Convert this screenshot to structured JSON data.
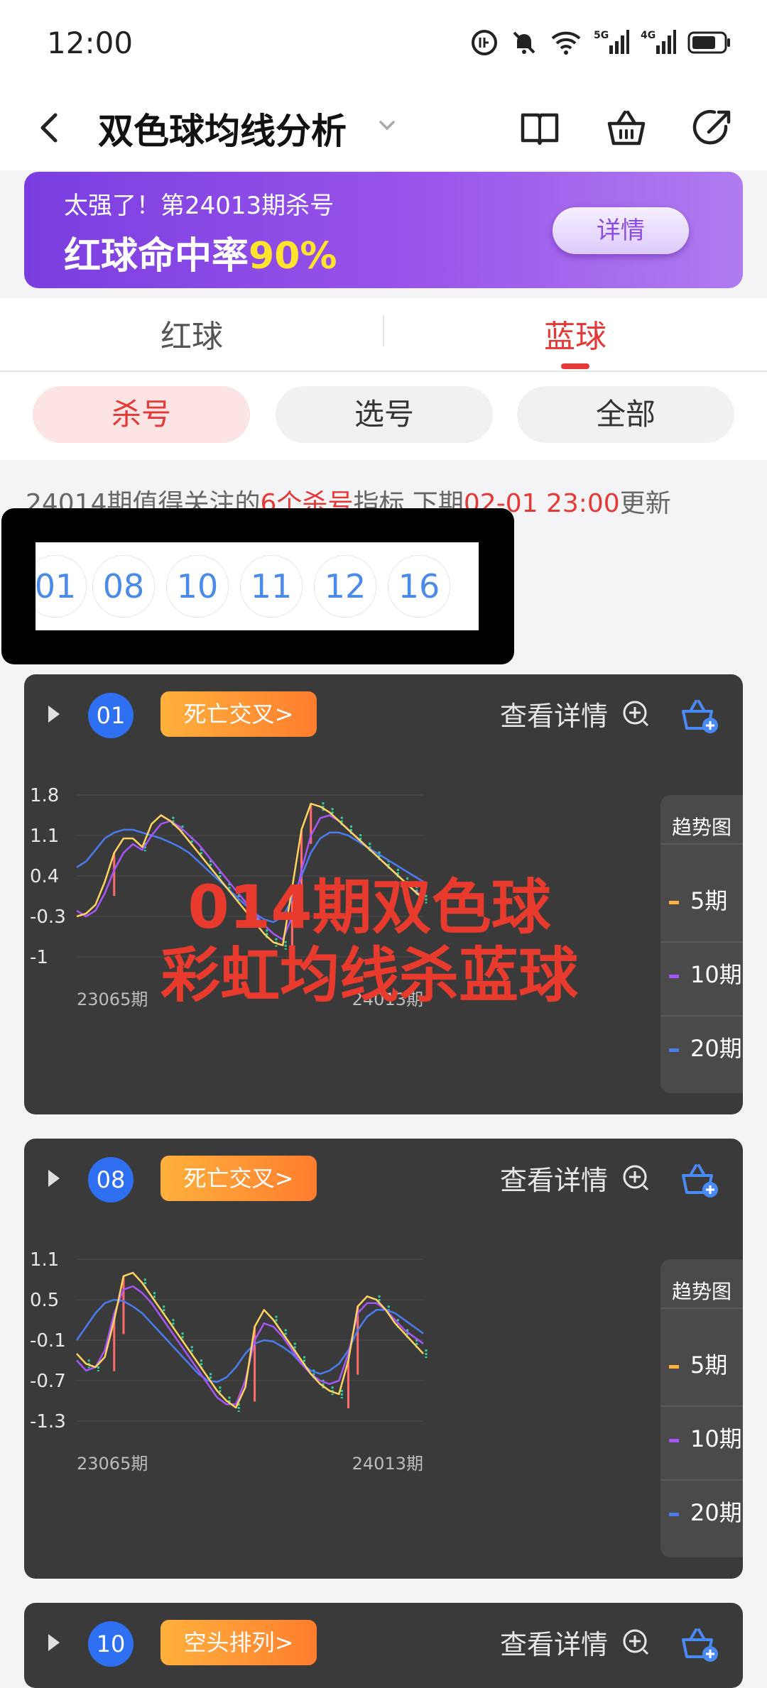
{
  "status": {
    "time": "12:00"
  },
  "header": {
    "title": "双色球均线分析"
  },
  "banner": {
    "line1": "太强了！第24013期杀号",
    "line2_prefix": "红球命中率",
    "line2_rate": "90%",
    "button": "详情"
  },
  "tabs": [
    {
      "label": "红球"
    },
    {
      "label": "蓝球"
    }
  ],
  "filters": [
    {
      "label": "杀号"
    },
    {
      "label": "选号"
    },
    {
      "label": "全部"
    }
  ],
  "notice": {
    "prefix": "24014期值得关注的",
    "count": "6个杀号",
    "mid": "指标 下期",
    "time": "02-01 23:00",
    "suffix": "更新"
  },
  "kill_numbers": [
    "01",
    "08",
    "10",
    "11",
    "12",
    "16"
  ],
  "colors": {
    "ma5": "#ffd460",
    "ma10": "#a855f7",
    "ma20": "#4a7cf0",
    "bull": "#2ed39a",
    "bear": "#ff6b6b"
  },
  "watermark": {
    "line1": "014期双色球",
    "line2": "彩虹均线杀蓝球"
  },
  "cards": [
    {
      "number": "01",
      "tag": "死亡交叉>",
      "detail": "查看详情",
      "legend_title": "趋势图",
      "legend": [
        "5期",
        "10期",
        "20期"
      ],
      "chart_data": {
        "type": "line",
        "yticks": [
          "1.8",
          "1.1",
          "0.4",
          "-0.3",
          "-1"
        ],
        "ylim": [
          -1,
          1.8
        ],
        "x_start": "23065期",
        "x_end": "24013期",
        "series": [
          {
            "name": "5期",
            "values": [
              -0.3,
              -0.25,
              -0.1,
              0.3,
              0.8,
              1.05,
              1.05,
              0.9,
              1.3,
              1.45,
              1.35,
              1.2,
              1.0,
              0.8,
              0.6,
              0.4,
              0.2,
              0.0,
              -0.2,
              -0.4,
              -0.6,
              -0.75,
              -0.8,
              0.2,
              1.2,
              1.65,
              1.6,
              1.5,
              1.35,
              1.2,
              1.05,
              0.9,
              0.75,
              0.6,
              0.45,
              0.3,
              0.15,
              0.0
            ]
          },
          {
            "name": "10期",
            "values": [
              -0.2,
              -0.3,
              -0.2,
              0.1,
              0.5,
              0.8,
              0.95,
              0.85,
              1.1,
              1.3,
              1.35,
              1.25,
              1.1,
              0.95,
              0.75,
              0.55,
              0.35,
              0.15,
              -0.05,
              -0.25,
              -0.45,
              -0.6,
              -0.7,
              -0.3,
              0.5,
              1.1,
              1.4,
              1.45,
              1.35,
              1.2,
              1.05,
              0.9,
              0.75,
              0.6,
              0.45,
              0.3,
              0.15,
              0.05
            ]
          },
          {
            "name": "20期",
            "values": [
              0.55,
              0.65,
              0.85,
              1.05,
              1.15,
              1.2,
              1.2,
              1.15,
              1.1,
              1.05,
              0.98,
              0.9,
              0.8,
              0.65,
              0.5,
              0.35,
              0.2,
              0.05,
              -0.1,
              -0.25,
              -0.35,
              -0.4,
              -0.3,
              0.0,
              0.4,
              0.8,
              1.05,
              1.15,
              1.15,
              1.1,
              1.0,
              0.9,
              0.8,
              0.7,
              0.6,
              0.5,
              0.4,
              0.3
            ]
          }
        ]
      }
    },
    {
      "number": "08",
      "tag": "死亡交叉>",
      "detail": "查看详情",
      "legend_title": "趋势图",
      "legend": [
        "5期",
        "10期",
        "20期"
      ],
      "chart_data": {
        "type": "line",
        "yticks": [
          "1.1",
          "0.5",
          "-0.1",
          "-0.7",
          "-1.3"
        ],
        "ylim": [
          -1.3,
          1.1
        ],
        "x_start": "23065期",
        "x_end": "24013期",
        "series": [
          {
            "name": "5期",
            "values": [
              -0.3,
              -0.45,
              -0.5,
              -0.35,
              0.2,
              0.85,
              0.9,
              0.75,
              0.55,
              0.35,
              0.15,
              -0.05,
              -0.25,
              -0.45,
              -0.65,
              -0.85,
              -1.0,
              -1.1,
              -0.8,
              0.1,
              0.35,
              0.2,
              0.0,
              -0.2,
              -0.4,
              -0.6,
              -0.75,
              -0.85,
              -0.9,
              -0.4,
              0.4,
              0.55,
              0.5,
              0.35,
              0.15,
              0.0,
              -0.15,
              -0.3
            ]
          },
          {
            "name": "10期",
            "values": [
              -0.4,
              -0.55,
              -0.5,
              -0.25,
              0.3,
              0.65,
              0.7,
              0.6,
              0.45,
              0.25,
              0.05,
              -0.15,
              -0.35,
              -0.55,
              -0.75,
              -0.95,
              -1.05,
              -1.05,
              -0.7,
              -0.1,
              0.15,
              0.1,
              -0.05,
              -0.25,
              -0.45,
              -0.6,
              -0.7,
              -0.75,
              -0.7,
              -0.3,
              0.3,
              0.45,
              0.45,
              0.35,
              0.2,
              0.05,
              -0.05,
              -0.15
            ]
          },
          {
            "name": "20期",
            "values": [
              -0.1,
              0.1,
              0.3,
              0.45,
              0.5,
              0.48,
              0.4,
              0.3,
              0.15,
              0.0,
              -0.15,
              -0.3,
              -0.45,
              -0.6,
              -0.7,
              -0.72,
              -0.65,
              -0.5,
              -0.3,
              -0.15,
              -0.1,
              -0.12,
              -0.2,
              -0.3,
              -0.45,
              -0.55,
              -0.6,
              -0.55,
              -0.45,
              -0.25,
              0.05,
              0.25,
              0.35,
              0.35,
              0.3,
              0.2,
              0.1,
              0.0
            ]
          }
        ]
      }
    },
    {
      "number": "10",
      "tag": "空头排列>",
      "detail": "查看详情"
    }
  ]
}
